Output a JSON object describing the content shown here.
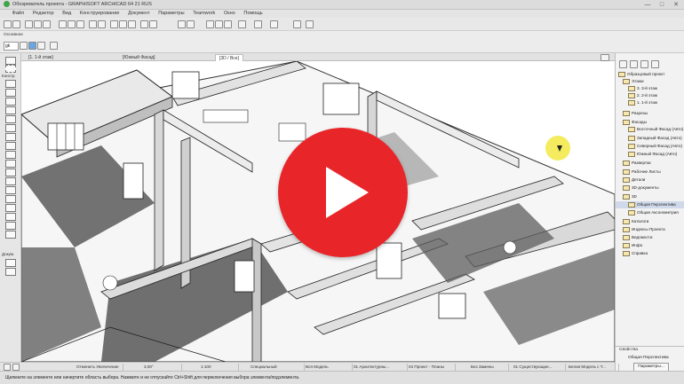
{
  "window": {
    "title": "Обозреватель проекта - GRAPHISOFT ARCHICAD 64 21 RUS",
    "minimize": "—",
    "maximize": "□",
    "close": "✕"
  },
  "menu": [
    "Файл",
    "Редактор",
    "Вид",
    "Конструирование",
    "Документ",
    "Параметры",
    "Teamwork",
    "Окно",
    "Помощь"
  ],
  "toolbar": {
    "info_label": "Основное",
    "layer_value": "gk"
  },
  "left_toolbox": {
    "construct_label": "Констр.",
    "docs_label": "Докум."
  },
  "tabs": [
    {
      "label": "[1. 1-й этаж]"
    },
    {
      "label": "[Южный Фасад]"
    },
    {
      "label": "[3D / Все]"
    }
  ],
  "navigator": {
    "header_icons": [
      "project-map-icon",
      "view-map-icon",
      "layout-book-icon",
      "publisher-icon"
    ],
    "items": [
      {
        "label": "Образцовый проект"
      },
      {
        "label": "Этажи"
      },
      {
        "label": "3. 3-й этаж"
      },
      {
        "label": "2. 2-й этаж"
      },
      {
        "label": "1. 1-й этаж"
      },
      {
        "label": "Разрезы"
      },
      {
        "label": "Фасады"
      },
      {
        "label": "Восточный Фасад (Авто)"
      },
      {
        "label": "Западный Фасад (Авто)"
      },
      {
        "label": "Северный Фасад (Авто)"
      },
      {
        "label": "Южный Фасад (Авто)"
      },
      {
        "label": "Развертки"
      },
      {
        "label": "Рабочие Листы"
      },
      {
        "label": "Детали"
      },
      {
        "label": "3D-документы"
      },
      {
        "label": "3D"
      },
      {
        "label": "Общая Перспектива",
        "selected": true
      },
      {
        "label": "Общая Аксонометрия"
      },
      {
        "label": "Каталоги"
      },
      {
        "label": "Индексы Проекта"
      },
      {
        "label": "Ведомости"
      },
      {
        "label": "Инфо"
      },
      {
        "label": "Справка"
      }
    ],
    "properties_label": "Свойства",
    "view_name": "Общая Перспектива",
    "params_button": "Параметры..."
  },
  "bottom_bar": [
    {
      "label": "Отменить Увеличение"
    },
    {
      "label": "3,00°"
    },
    {
      "label": "1:100"
    },
    {
      "label": "Специальный"
    },
    {
      "label": "Вся Модель"
    },
    {
      "label": "01 Архитектурны..."
    },
    {
      "label": "04 Проект - Планы"
    },
    {
      "label": "Без Замены"
    },
    {
      "label": "01 Существующие..."
    },
    {
      "label": "Белая Модель с Т..."
    }
  ],
  "status": {
    "text": "Щелкните на элементе или начертите область выбора. Нажмите и не отпускайте Ctrl+Shift для переключения выбора элемента/подэлемента."
  },
  "video_overlay": {
    "play_label": "play"
  },
  "colors": {
    "play_red": "#e8262a",
    "cursor_highlight": "#f0e628",
    "selection_blue": "#cfd9ea"
  }
}
